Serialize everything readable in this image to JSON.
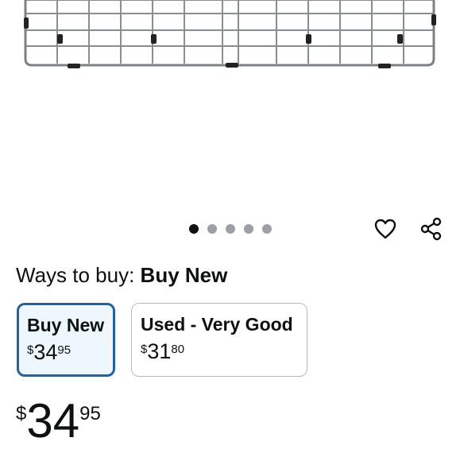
{
  "carousel": {
    "dot_count": 5,
    "active_index": 0
  },
  "icons": {
    "wishlist": "heart-icon",
    "share": "share-icon"
  },
  "ways_to_buy": {
    "prefix": "Ways to buy:",
    "selected": "Buy New"
  },
  "options": [
    {
      "title": "Buy New",
      "currency": "$",
      "whole": "34",
      "fraction": "95",
      "selected": true
    },
    {
      "title": "Used - Very Good",
      "currency": "$",
      "whole": "31",
      "fraction": "80",
      "selected": false
    }
  ],
  "price": {
    "currency": "$",
    "whole": "34",
    "fraction": "95"
  },
  "colors": {
    "selected_border": "#2162a1",
    "selected_bg": "#edf7fd",
    "text": "#0f1111",
    "dot_inactive": "#9aa0a6"
  }
}
